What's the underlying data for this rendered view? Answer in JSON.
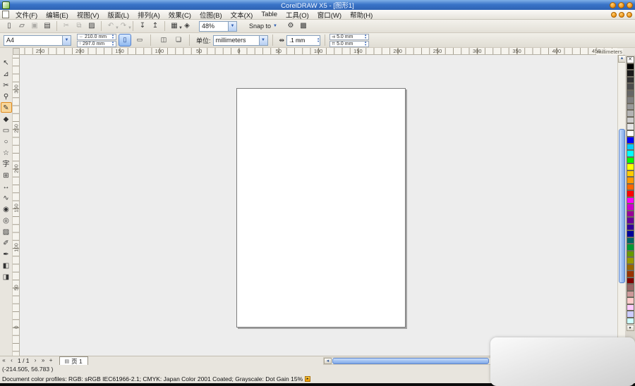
{
  "title_bar": {
    "title": "CorelDRAW X5 - [图形1]"
  },
  "menu": {
    "items": [
      "文件(F)",
      "编辑(E)",
      "视图(V)",
      "版面(L)",
      "排列(A)",
      "效果(C)",
      "位图(B)",
      "文本(X)",
      "Table",
      "工具(O)",
      "窗口(W)",
      "帮助(H)"
    ]
  },
  "toolbar": {
    "zoom_value": "48%",
    "snap_label": "Snap to",
    "icons_left": [
      {
        "name": "new-document-button",
        "glyph": "▯"
      },
      {
        "name": "open-button",
        "glyph": "▱"
      },
      {
        "name": "save-button",
        "glyph": "▣",
        "disabled": true
      },
      {
        "name": "print-button",
        "glyph": "▤"
      },
      {
        "sep": true
      },
      {
        "name": "cut-button",
        "glyph": "✂",
        "disabled": true
      },
      {
        "name": "copy-button",
        "glyph": "⧉",
        "disabled": true
      },
      {
        "name": "paste-button",
        "glyph": "▨"
      },
      {
        "sep": true
      },
      {
        "name": "undo-button",
        "glyph": "↶",
        "drop": true,
        "disabled": true
      },
      {
        "name": "redo-button",
        "glyph": "↷",
        "drop": true,
        "disabled": true
      },
      {
        "sep": true
      },
      {
        "name": "import-button",
        "glyph": "↧"
      },
      {
        "name": "export-button",
        "glyph": "↥"
      },
      {
        "sep": true
      },
      {
        "name": "application-launcher-button",
        "glyph": "▦",
        "drop": true
      },
      {
        "name": "welcome-screen-button",
        "glyph": "◈"
      }
    ],
    "icons_right": [
      {
        "name": "options-button",
        "glyph": "⚙"
      },
      {
        "name": "guidelines-button",
        "glyph": "▩"
      }
    ]
  },
  "property_bar": {
    "preset": "A4",
    "paper_width": "210.0 mm",
    "paper_height": "297.0 mm",
    "units_label": "单位:",
    "units_value": "millimeters",
    "nudge_value": ".1 mm",
    "duplicate_x": "5.0 mm",
    "duplicate_y": "5.0 mm"
  },
  "rulers": {
    "h_labels": [
      "250",
      "200",
      "150",
      "100",
      "50",
      "0",
      "50",
      "100",
      "150",
      "200",
      "250",
      "300",
      "350",
      "400",
      "450"
    ],
    "v_labels": [
      "300",
      "250",
      "200",
      "150",
      "100",
      "50",
      "0"
    ],
    "unit_text": "millimeters"
  },
  "toolbox": {
    "active_index": 4,
    "tools": [
      {
        "name": "pick-tool",
        "glyph": "↖"
      },
      {
        "name": "shape-tool",
        "glyph": "⊿"
      },
      {
        "name": "crop-tool",
        "glyph": "✂"
      },
      {
        "name": "zoom-tool",
        "glyph": "⚲"
      },
      {
        "name": "freehand-tool",
        "glyph": "✎"
      },
      {
        "name": "smart-fill-tool",
        "glyph": "◆"
      },
      {
        "name": "rectangle-tool",
        "glyph": "▭"
      },
      {
        "name": "ellipse-tool",
        "glyph": "○"
      },
      {
        "name": "polygon-tool",
        "glyph": "☆"
      },
      {
        "name": "text-tool",
        "glyph": "字"
      },
      {
        "name": "table-tool",
        "glyph": "⊞"
      },
      {
        "name": "dimension-tool",
        "glyph": "↔"
      },
      {
        "name": "connector-tool",
        "glyph": "∿"
      },
      {
        "name": "blend-tool",
        "glyph": "◉"
      },
      {
        "name": "contour-tool",
        "glyph": "◎"
      },
      {
        "name": "transparency-tool",
        "glyph": "▨"
      },
      {
        "name": "eyedropper-tool",
        "glyph": "✐"
      },
      {
        "name": "outline-pen-tool",
        "glyph": "✒"
      },
      {
        "name": "fill-tool",
        "glyph": "◧"
      },
      {
        "name": "interactive-fill-tool",
        "glyph": "◨"
      }
    ]
  },
  "palette": {
    "colors": [
      "none",
      "#000000",
      "#1a1a1a",
      "#333333",
      "#4d4d4d",
      "#666666",
      "#808080",
      "#999999",
      "#b3b3b3",
      "#cccccc",
      "#e6e6e6",
      "#ffffff",
      "#0000ff",
      "#00ccff",
      "#00ffff",
      "#00ff00",
      "#ffff00",
      "#ffcc00",
      "#ff9900",
      "#ff6600",
      "#ff0000",
      "#ff00ff",
      "#cc00cc",
      "#990099",
      "#660099",
      "#330099",
      "#000099",
      "#006666",
      "#009933",
      "#669900",
      "#999900",
      "#996600",
      "#993300",
      "#800000",
      "#996666",
      "#cc9999",
      "#ffcccc",
      "#ffccff",
      "#ccccff",
      "#ccffff"
    ]
  },
  "pagebar": {
    "nav_first": "«",
    "nav_prev": "‹",
    "page_indicator": "1 / 1",
    "nav_next": "›",
    "nav_last": "»",
    "add_page": "+",
    "tab_icon": "▤",
    "page_tab": "页 1"
  },
  "status": {
    "coordinates": "(-214.505, 56.783 )",
    "profiles": "Document color profiles: RGB: sRGB IEC61966-2.1; CMYK: Japan Color 2001 Coated; Grayscale: Dot Gain 15%"
  }
}
